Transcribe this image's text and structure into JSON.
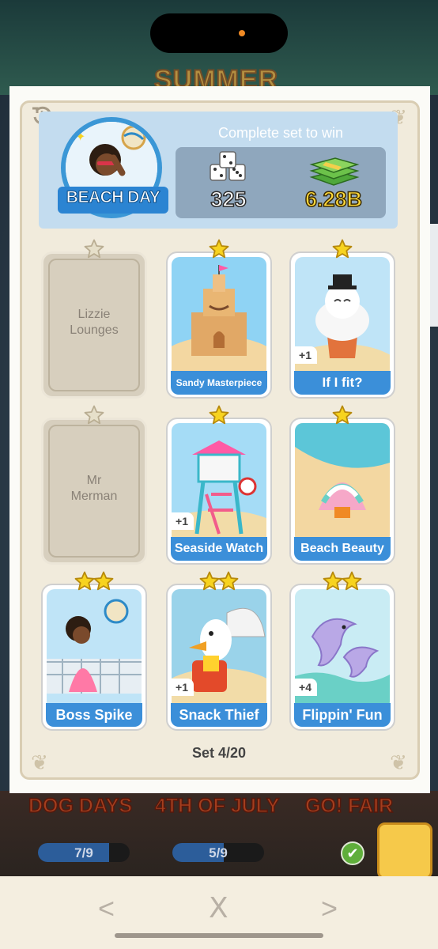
{
  "background": {
    "banner_title": "SUMMER",
    "other_sets": [
      {
        "name": "DOG DAYS",
        "progress": "7/9",
        "fraction": 0.78
      },
      {
        "name": "4TH OF JULY",
        "progress": "5/9",
        "fraction": 0.56
      },
      {
        "name": "GO! FAIR",
        "progress": "",
        "fraction": 0
      }
    ],
    "check_glyph": "✔"
  },
  "album": {
    "set_name": "BEACH DAY",
    "reward_label": "Complete set to win",
    "rewards": {
      "dice": "325",
      "cash": "6.28B"
    },
    "set_progress": "Set 4/20",
    "stickers": [
      {
        "name": "Lizzie Lounges",
        "locked": true,
        "stars": 1,
        "extra": "",
        "label_size": 16,
        "locked_text": "Lizzie\nLounges"
      },
      {
        "name": "Sandy Masterpiece",
        "locked": false,
        "stars": 1,
        "extra": "",
        "label_size": 12
      },
      {
        "name": "If I fit?",
        "locked": false,
        "stars": 1,
        "extra": "+1",
        "label_size": 17
      },
      {
        "name": "Mr Merman",
        "locked": true,
        "stars": 1,
        "extra": "",
        "label_size": 16,
        "locked_text": "Mr\nMerman"
      },
      {
        "name": "Seaside Watch",
        "locked": false,
        "stars": 1,
        "extra": "+1",
        "label_size": 16
      },
      {
        "name": "Beach Beauty",
        "locked": false,
        "stars": 1,
        "extra": "",
        "label_size": 16
      },
      {
        "name": "Boss Spike",
        "locked": false,
        "stars": 2,
        "extra": "",
        "label_size": 18
      },
      {
        "name": "Snack Thief",
        "locked": false,
        "stars": 2,
        "extra": "+1",
        "label_size": 18
      },
      {
        "name": "Flippin' Fun",
        "locked": false,
        "stars": 2,
        "extra": "+4",
        "label_size": 18
      }
    ]
  },
  "nav": {
    "prev": "<",
    "close": "X",
    "next": ">"
  },
  "side_tab_arrow": "‹",
  "icons": [
    "rewind-icon",
    "dice-icon",
    "cash-stack-icon",
    "star-icon",
    "check-icon",
    "chevron-left-icon",
    "close-icon",
    "chevron-right-icon"
  ],
  "colors": {
    "accent_blue": "#3b8fd9",
    "star_gold": "#f7d31f",
    "paper": "#f1ebdc"
  }
}
